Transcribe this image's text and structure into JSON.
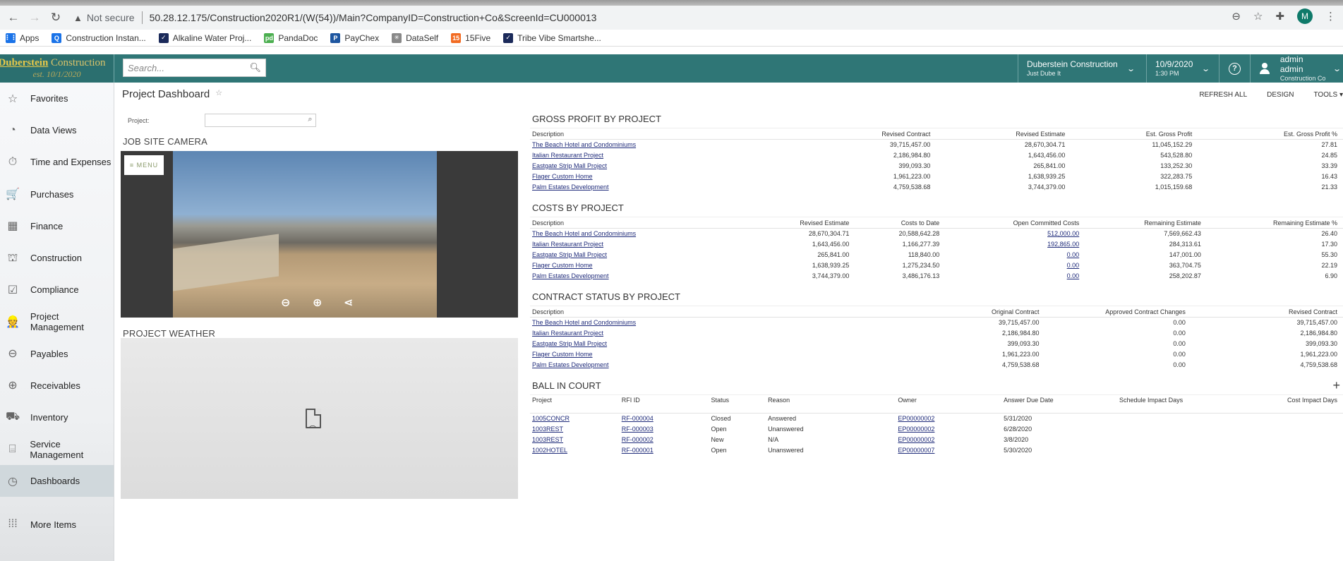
{
  "browser": {
    "back": "←",
    "forward": "→",
    "reload": "↻",
    "security_icon": "▲",
    "security_text": "Not secure",
    "url": "50.28.12.175/Construction2020R1/(W(54))/Main?CompanyID=Construction+Co&ScreenId=CU000013",
    "profile_initial": "M",
    "bookmarks": [
      {
        "label": "Apps",
        "icon": "apps-grid-icon",
        "color": "#1a73e8",
        "glyph": "⋮⋮"
      },
      {
        "label": "Construction Instan...",
        "icon": "construction-icon",
        "color": "#1a73e8",
        "glyph": "Q"
      },
      {
        "label": "Alkaline Water Proj...",
        "icon": "smartsheet-icon",
        "color": "#1b2a5a",
        "glyph": "✓"
      },
      {
        "label": "PandaDoc",
        "icon": "pandadoc-icon",
        "color": "#4caf50",
        "glyph": "pd"
      },
      {
        "label": "PayChex",
        "icon": "paychex-icon",
        "color": "#1e56a0",
        "glyph": "P"
      },
      {
        "label": "DataSelf",
        "icon": "dataself-icon",
        "color": "#888888",
        "glyph": "✳"
      },
      {
        "label": "15Five",
        "icon": "15five-icon",
        "color": "#f26b22",
        "glyph": "15"
      },
      {
        "label": "Tribe Vibe Smartshe...",
        "icon": "smartsheet-icon",
        "color": "#1b2a5a",
        "glyph": "✓"
      }
    ]
  },
  "header": {
    "logo_line1_bold": "Duberstein",
    "logo_line1_rest": " Construction",
    "logo_line2": "est. 10/1/2020",
    "search_placeholder": "Search...",
    "company_name": "Duberstein Construction",
    "company_sub": "Just Dube It",
    "date": "10/9/2020",
    "time": "1:30 PM",
    "help": "?",
    "user_name": "admin admin",
    "user_company": "Construction Co"
  },
  "sidebar": {
    "items": [
      {
        "label": "Favorites",
        "icon": "☆",
        "name": "star-icon"
      },
      {
        "label": "Data Views",
        "icon": "◔",
        "name": "pie-chart-icon"
      },
      {
        "label": "Time and Expenses",
        "icon": "⏱",
        "name": "stopwatch-icon"
      },
      {
        "label": "Purchases",
        "icon": "🛒",
        "name": "cart-icon"
      },
      {
        "label": "Finance",
        "icon": "▦",
        "name": "calculator-icon"
      },
      {
        "label": "Construction",
        "icon": "⛫",
        "name": "crane-icon"
      },
      {
        "label": "Compliance",
        "icon": "☑",
        "name": "checklist-icon"
      },
      {
        "label": "Project Management",
        "icon": "👷",
        "name": "worker-icon"
      },
      {
        "label": "Payables",
        "icon": "⊖",
        "name": "minus-circle-icon"
      },
      {
        "label": "Receivables",
        "icon": "⊕",
        "name": "plus-circle-icon"
      },
      {
        "label": "Inventory",
        "icon": "⛟",
        "name": "truck-icon"
      },
      {
        "label": "Service Management",
        "icon": "⌸",
        "name": "toolbox-icon"
      },
      {
        "label": "Dashboards",
        "icon": "◷",
        "name": "gauge-icon"
      },
      {
        "label": "More Items",
        "icon": "⁞⁞⁞",
        "name": "more-grid-icon"
      }
    ],
    "active": "Dashboards"
  },
  "page": {
    "title": "Project Dashboard",
    "actions": {
      "refresh": "REFRESH ALL",
      "design": "DESIGN",
      "tools": "TOOLS ▾"
    },
    "project_label": "Project:",
    "project_value": ""
  },
  "camera": {
    "title": "JOB SITE CAMERA",
    "menu_label": "≡ MENU"
  },
  "weather": {
    "title": "PROJECT WEATHER"
  },
  "gross_profit": {
    "title": "GROSS PROFIT BY PROJECT",
    "columns": [
      "Description",
      "Revised Contract",
      "Revised Estimate",
      "Est. Gross Profit",
      "Est. Gross Profit %"
    ],
    "rows": [
      [
        "The Beach Hotel and Condominiums",
        "39,715,457.00",
        "28,670,304.71",
        "11,045,152.29",
        "27.81"
      ],
      [
        "Italian Restaurant Project",
        "2,186,984.80",
        "1,643,456.00",
        "543,528.80",
        "24.85"
      ],
      [
        "Eastgate Strip Mall Project",
        "399,093.30",
        "265,841.00",
        "133,252.30",
        "33.39"
      ],
      [
        "Flager Custom Home",
        "1,961,223.00",
        "1,638,939.25",
        "322,283.75",
        "16.43"
      ],
      [
        "Palm Estates Development",
        "4,759,538.68",
        "3,744,379.00",
        "1,015,159.68",
        "21.33"
      ]
    ]
  },
  "costs": {
    "title": "COSTS BY PROJECT",
    "columns": [
      "Description",
      "Revised Estimate",
      "Costs to Date",
      "Open Committed Costs",
      "Remaining Estimate",
      "Remaining Estimate %"
    ],
    "rows": [
      [
        "The Beach Hotel and Condominiums",
        "28,670,304.71",
        "20,588,642.28",
        "512,000.00",
        "7,569,662.43",
        "26.40"
      ],
      [
        "Italian Restaurant Project",
        "1,643,456.00",
        "1,166,277.39",
        "192,865.00",
        "284,313.61",
        "17.30"
      ],
      [
        "Eastgate Strip Mall Project",
        "265,841.00",
        "118,840.00",
        "0.00",
        "147,001.00",
        "55.30"
      ],
      [
        "Flager Custom Home",
        "1,638,939.25",
        "1,275,234.50",
        "0.00",
        "363,704.75",
        "22.19"
      ],
      [
        "Palm Estates Development",
        "3,744,379.00",
        "3,486,176.13",
        "0.00",
        "258,202.87",
        "6.90"
      ]
    ]
  },
  "contract_status": {
    "title": "CONTRACT STATUS BY PROJECT",
    "columns": [
      "Description",
      "Original Contract",
      "Approved Contract Changes",
      "Revised Contract"
    ],
    "rows": [
      [
        "The Beach Hotel and Condominiums",
        "39,715,457.00",
        "0.00",
        "39,715,457.00"
      ],
      [
        "Italian Restaurant Project",
        "2,186,984.80",
        "0.00",
        "2,186,984.80"
      ],
      [
        "Eastgate Strip Mall Project",
        "399,093.30",
        "0.00",
        "399,093.30"
      ],
      [
        "Flager Custom Home",
        "1,961,223.00",
        "0.00",
        "1,961,223.00"
      ],
      [
        "Palm Estates Development",
        "4,759,538.68",
        "0.00",
        "4,759,538.68"
      ]
    ]
  },
  "ball_in_court": {
    "title": "BALL IN COURT",
    "add": "+",
    "columns": [
      "Project",
      "RFI ID",
      "Status",
      "Reason",
      "Owner",
      "Answer Due Date",
      "Schedule Impact Days",
      "Cost Impact Days"
    ],
    "rows": [
      [
        "1005CONCR",
        "RF-000004",
        "Closed",
        "Answered",
        "EP00000002",
        "5/31/2020",
        "",
        ""
      ],
      [
        "1003REST",
        "RF-000003",
        "Open",
        "Unanswered",
        "EP00000002",
        "6/28/2020",
        "",
        ""
      ],
      [
        "1003REST",
        "RF-000002",
        "New",
        "N/A",
        "EP00000002",
        "3/8/2020",
        "",
        ""
      ],
      [
        "1002HOTEL",
        "RF-000001",
        "Open",
        "Unanswered",
        "EP00000007",
        "5/30/2020",
        "",
        ""
      ]
    ]
  }
}
